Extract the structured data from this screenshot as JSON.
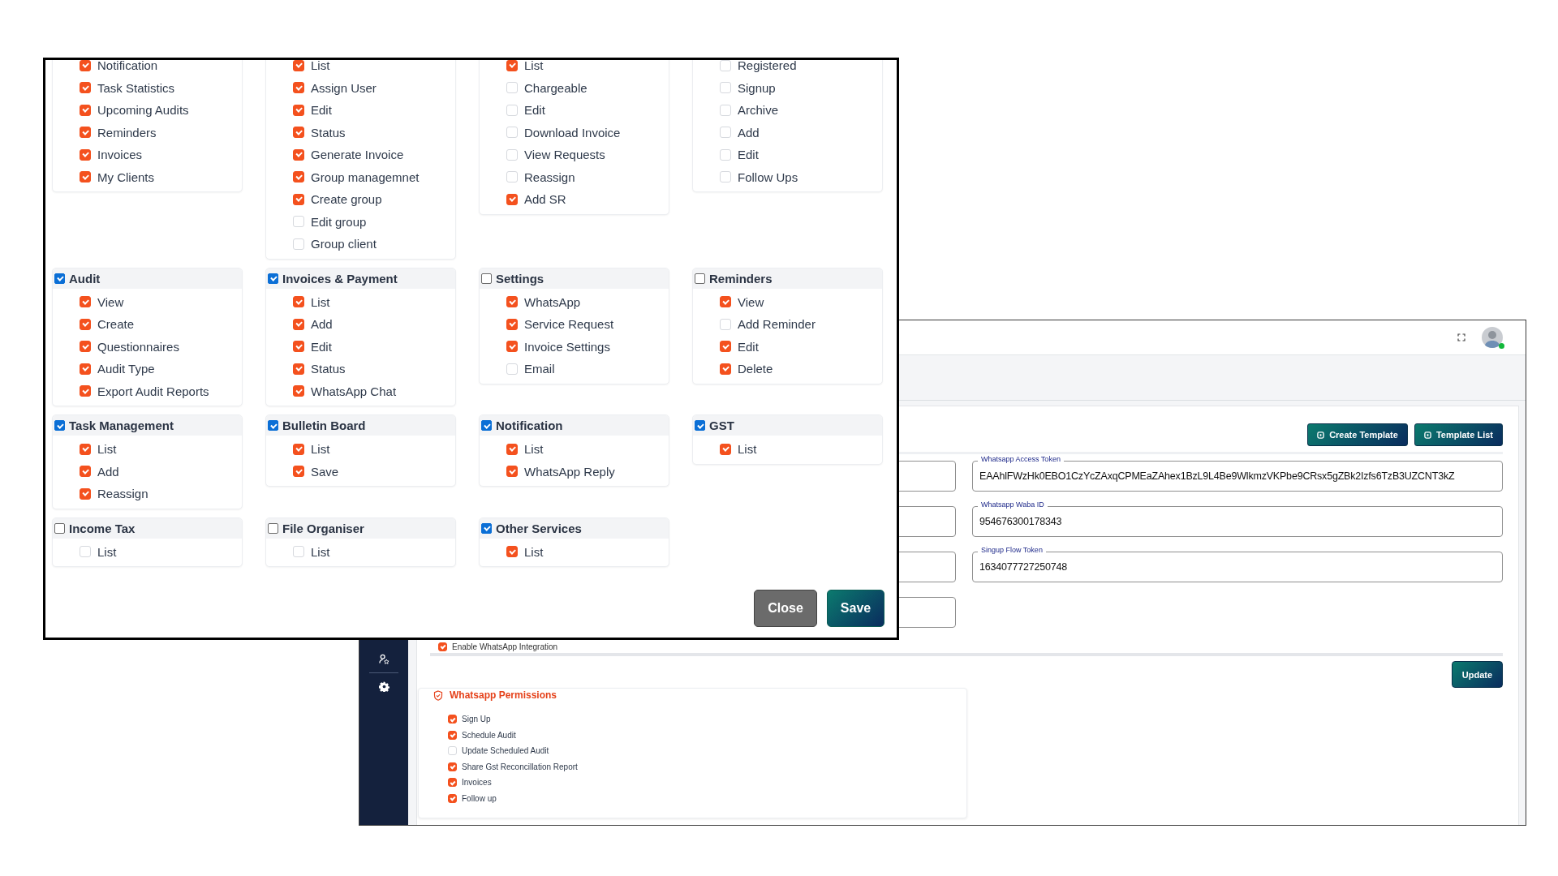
{
  "modal": {
    "groups": [
      {
        "items": [
          {
            "label": "Notification",
            "checked": true
          },
          {
            "label": "Task Statistics",
            "checked": true
          },
          {
            "label": "Upcoming Audits",
            "checked": true
          },
          {
            "label": "Reminders",
            "checked": true
          },
          {
            "label": "Invoices",
            "checked": true
          },
          {
            "label": "My Clients",
            "checked": true
          }
        ]
      },
      {
        "items": [
          {
            "label": "List",
            "checked": true
          },
          {
            "label": "Assign User",
            "checked": true
          },
          {
            "label": "Edit",
            "checked": true
          },
          {
            "label": "Status",
            "checked": true
          },
          {
            "label": "Generate Invoice",
            "checked": true
          },
          {
            "label": "Group managemnet",
            "checked": true
          },
          {
            "label": "Create group",
            "checked": true
          },
          {
            "label": "Edit group",
            "checked": false
          },
          {
            "label": "Group client",
            "checked": false
          }
        ]
      },
      {
        "items": [
          {
            "label": "List",
            "checked": true
          },
          {
            "label": "Chargeable",
            "checked": false
          },
          {
            "label": "Edit",
            "checked": false
          },
          {
            "label": "Download Invoice",
            "checked": false
          },
          {
            "label": "View Requests",
            "checked": false
          },
          {
            "label": "Reassign",
            "checked": false
          },
          {
            "label": "Add SR",
            "checked": true
          }
        ]
      },
      {
        "items": [
          {
            "label": "Registered",
            "checked": false
          },
          {
            "label": "Signup",
            "checked": false
          },
          {
            "label": "Archive",
            "checked": false
          },
          {
            "label": "Add",
            "checked": false
          },
          {
            "label": "Edit",
            "checked": false
          },
          {
            "label": "Follow Ups",
            "checked": false
          }
        ]
      },
      {
        "title": "Audit",
        "checked": true,
        "items": [
          {
            "label": "View",
            "checked": true
          },
          {
            "label": "Create",
            "checked": true
          },
          {
            "label": "Questionnaires",
            "checked": true
          },
          {
            "label": "Audit Type",
            "checked": true
          },
          {
            "label": "Export Audit Reports",
            "checked": true
          }
        ]
      },
      {
        "title": "Invoices & Payment",
        "checked": true,
        "items": [
          {
            "label": "List",
            "checked": true
          },
          {
            "label": "Add",
            "checked": true
          },
          {
            "label": "Edit",
            "checked": true
          },
          {
            "label": "Status",
            "checked": true
          },
          {
            "label": "WhatsApp Chat",
            "checked": true
          }
        ]
      },
      {
        "title": "Settings",
        "checked": false,
        "items": [
          {
            "label": "WhatsApp",
            "checked": true
          },
          {
            "label": "Service Request",
            "checked": true
          },
          {
            "label": "Invoice Settings",
            "checked": true
          },
          {
            "label": "Email",
            "checked": false
          }
        ]
      },
      {
        "title": "Reminders",
        "checked": false,
        "items": [
          {
            "label": "View",
            "checked": true
          },
          {
            "label": "Add Reminder",
            "checked": false
          },
          {
            "label": "Edit",
            "checked": true
          },
          {
            "label": "Delete",
            "checked": true
          }
        ]
      },
      {
        "title": "Task Management",
        "checked": true,
        "items": [
          {
            "label": "List",
            "checked": true
          },
          {
            "label": "Add",
            "checked": true
          },
          {
            "label": "Reassign",
            "checked": true
          }
        ]
      },
      {
        "title": "Bulletin Board",
        "checked": true,
        "items": [
          {
            "label": "List",
            "checked": true
          },
          {
            "label": "Save",
            "checked": true
          }
        ]
      },
      {
        "title": "Notification",
        "checked": true,
        "items": [
          {
            "label": "List",
            "checked": true
          },
          {
            "label": "WhatsApp Reply",
            "checked": true
          }
        ]
      },
      {
        "title": "GST",
        "checked": true,
        "items": [
          {
            "label": "List",
            "checked": true
          }
        ]
      },
      {
        "title": "Income Tax",
        "checked": false,
        "items": [
          {
            "label": "List",
            "checked": false
          }
        ]
      },
      {
        "title": "File Organiser",
        "checked": false,
        "items": [
          {
            "label": "List",
            "checked": false
          }
        ]
      },
      {
        "title": "Other Services",
        "checked": true,
        "items": [
          {
            "label": "List",
            "checked": true
          }
        ]
      }
    ],
    "buttons": [
      {
        "label": "Close",
        "kind": "secondary"
      },
      {
        "label": "Save",
        "kind": "primary"
      }
    ]
  },
  "background": {
    "avatar": {
      "online": true
    },
    "toolbar_buttons": [
      {
        "label": "Create Template"
      },
      {
        "label": "Template List"
      }
    ],
    "fields": [
      {
        "label": "Whatsapp Access Token",
        "value": "EAAhlFWzHk0EBO1CzYcZAxqCPMEaZAhex1BzL9L4Be9WlkmzVKPbe9CRsx5gZBk2Izfs6TzB3UZCNT3kZ"
      },
      {
        "label": "Whatsapp Waba ID",
        "value": "954676300178343"
      },
      {
        "label": "Singup Flow Token",
        "value": "1634077727250748"
      }
    ],
    "enable_integration": {
      "label": "Enable WhatsApp Integration",
      "checked": true
    },
    "update_button": "Update",
    "permissions": {
      "title": "Whatsapp Permissions",
      "items": [
        {
          "label": "Sign Up",
          "checked": true
        },
        {
          "label": "Schedule Audit",
          "checked": true
        },
        {
          "label": "Update Scheduled Audit",
          "checked": false
        },
        {
          "label": "Share Gst Reconcillation Report",
          "checked": true
        },
        {
          "label": "Invoices",
          "checked": true
        },
        {
          "label": "Follow up",
          "checked": true
        }
      ]
    }
  }
}
